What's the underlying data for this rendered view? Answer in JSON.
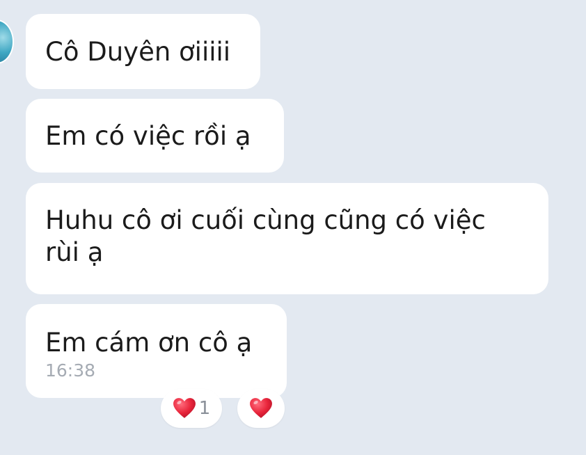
{
  "messages": [
    {
      "text": "Cô Duyên ơiiiii"
    },
    {
      "text": "Em có việc rồi ạ"
    },
    {
      "text": "Huhu cô ơi cuối cùng cũng có việc\nrùi ạ"
    },
    {
      "text": "Em cám ơn cô ạ",
      "time": "16:38"
    }
  ],
  "reactions": {
    "heart_count": "1",
    "heart_icon": "heart-icon",
    "add_reaction_icon": "heart-icon"
  },
  "colors": {
    "background": "#e3e9f1",
    "bubble": "#ffffff",
    "text": "#1b1b1b",
    "timestamp": "#a5abb3",
    "heart": "#e8243a"
  }
}
